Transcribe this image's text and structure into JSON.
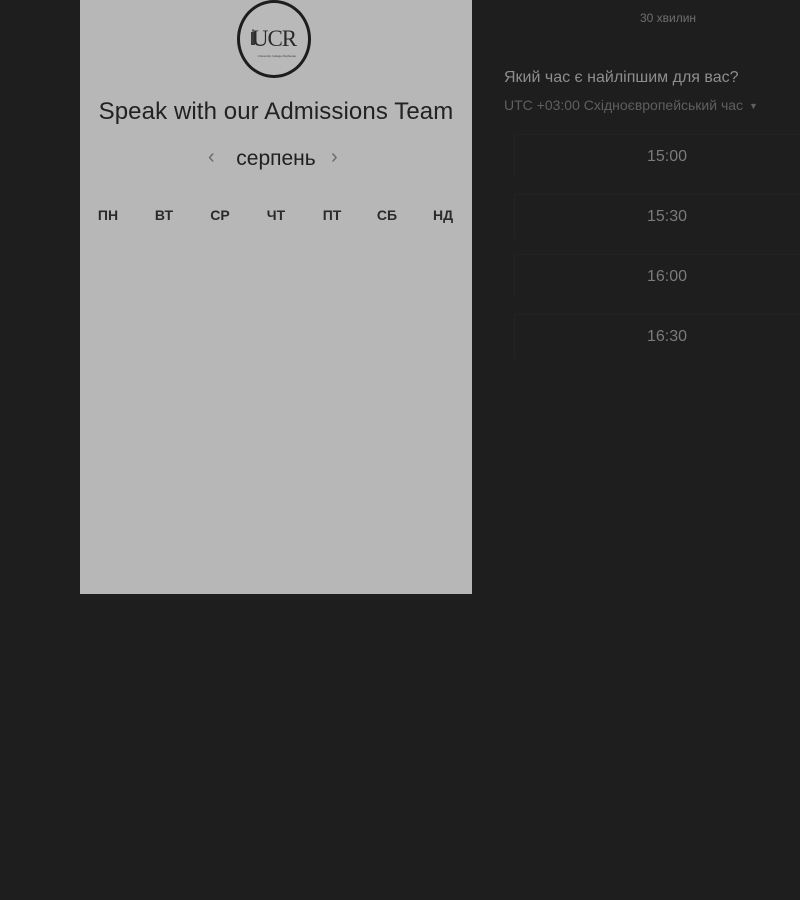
{
  "calendar": {
    "logo": {
      "mark": "UCR",
      "subtitle": "University College Rochester",
      "icon": "university-logo-icon"
    },
    "title": "Speak with our Admissions Team",
    "month": "серпень",
    "prev_icon": "chevron-left-icon",
    "next_icon": "chevron-right-icon",
    "weekdays": [
      "ПН",
      "ВТ",
      "СР",
      "ЧТ",
      "ПТ",
      "СБ",
      "НД"
    ]
  },
  "booking": {
    "duration": "30 хвилин",
    "question": "Який час є найліпшим для вас?",
    "timezone": "UTC +03:00 Східноєвропейський час",
    "timezone_icon": "caret-down-icon",
    "slots": [
      "15:00",
      "15:30",
      "16:00",
      "16:30"
    ]
  },
  "colors": {
    "page_background": "#1e1e1e",
    "calendar_panel": "#b7b7b7",
    "title_text": "#222222",
    "slot_text": "#7b7b7b"
  }
}
